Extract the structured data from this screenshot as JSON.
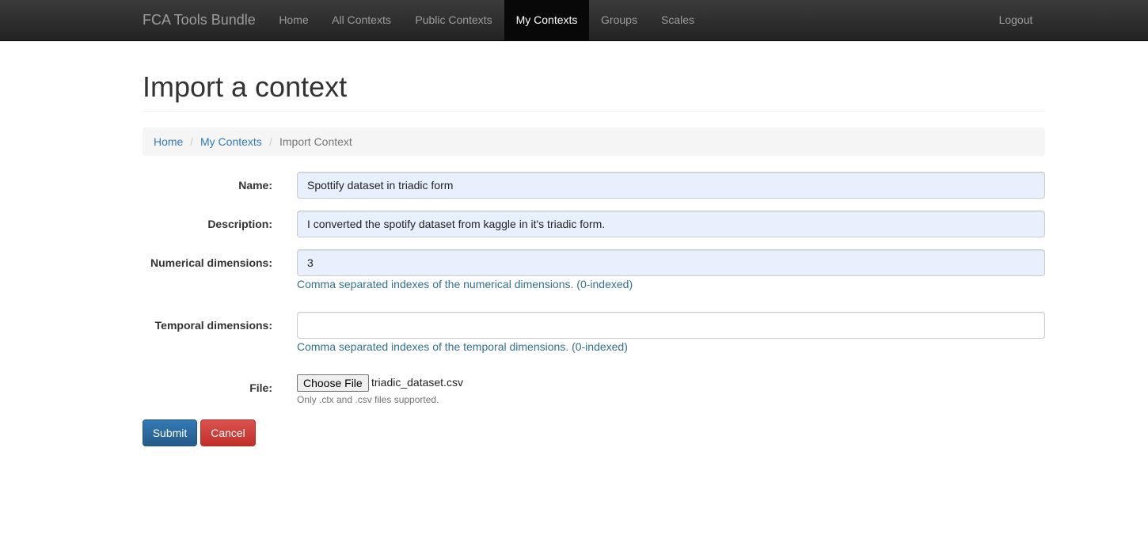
{
  "navbar": {
    "brand": "FCA Tools Bundle",
    "items": [
      {
        "label": "Home"
      },
      {
        "label": "All Contexts"
      },
      {
        "label": "Public Contexts"
      },
      {
        "label": "My Contexts",
        "active": true
      },
      {
        "label": "Groups"
      },
      {
        "label": "Scales"
      }
    ],
    "logout": "Logout"
  },
  "page": {
    "title": "Import a context"
  },
  "breadcrumb": {
    "items": [
      "Home",
      "My Contexts",
      "Import Context"
    ],
    "separator": "/"
  },
  "form": {
    "name": {
      "label": "Name:",
      "value": "Spottify dataset in triadic form"
    },
    "description": {
      "label": "Description:",
      "value": "I converted the spotify dataset from kaggle in it's triadic form."
    },
    "numerical": {
      "label": "Numerical dimensions:",
      "value": "3",
      "help": "Comma separated indexes of the numerical dimensions. (0-indexed)"
    },
    "temporal": {
      "label": "Temporal dimensions:",
      "value": "",
      "help": "Comma separated indexes of the temporal dimensions. (0-indexed)"
    },
    "file": {
      "label": "File:",
      "button": "Choose File",
      "filename": "triadic_dataset.csv",
      "help": "Only .ctx and .csv files supported."
    }
  },
  "actions": {
    "submit": "Submit",
    "cancel": "Cancel"
  },
  "colors": {
    "primary": "#337ab7",
    "danger": "#d9534f",
    "navbar": "#222222",
    "autofill": "#e8f0fe",
    "help": "#31708f"
  }
}
